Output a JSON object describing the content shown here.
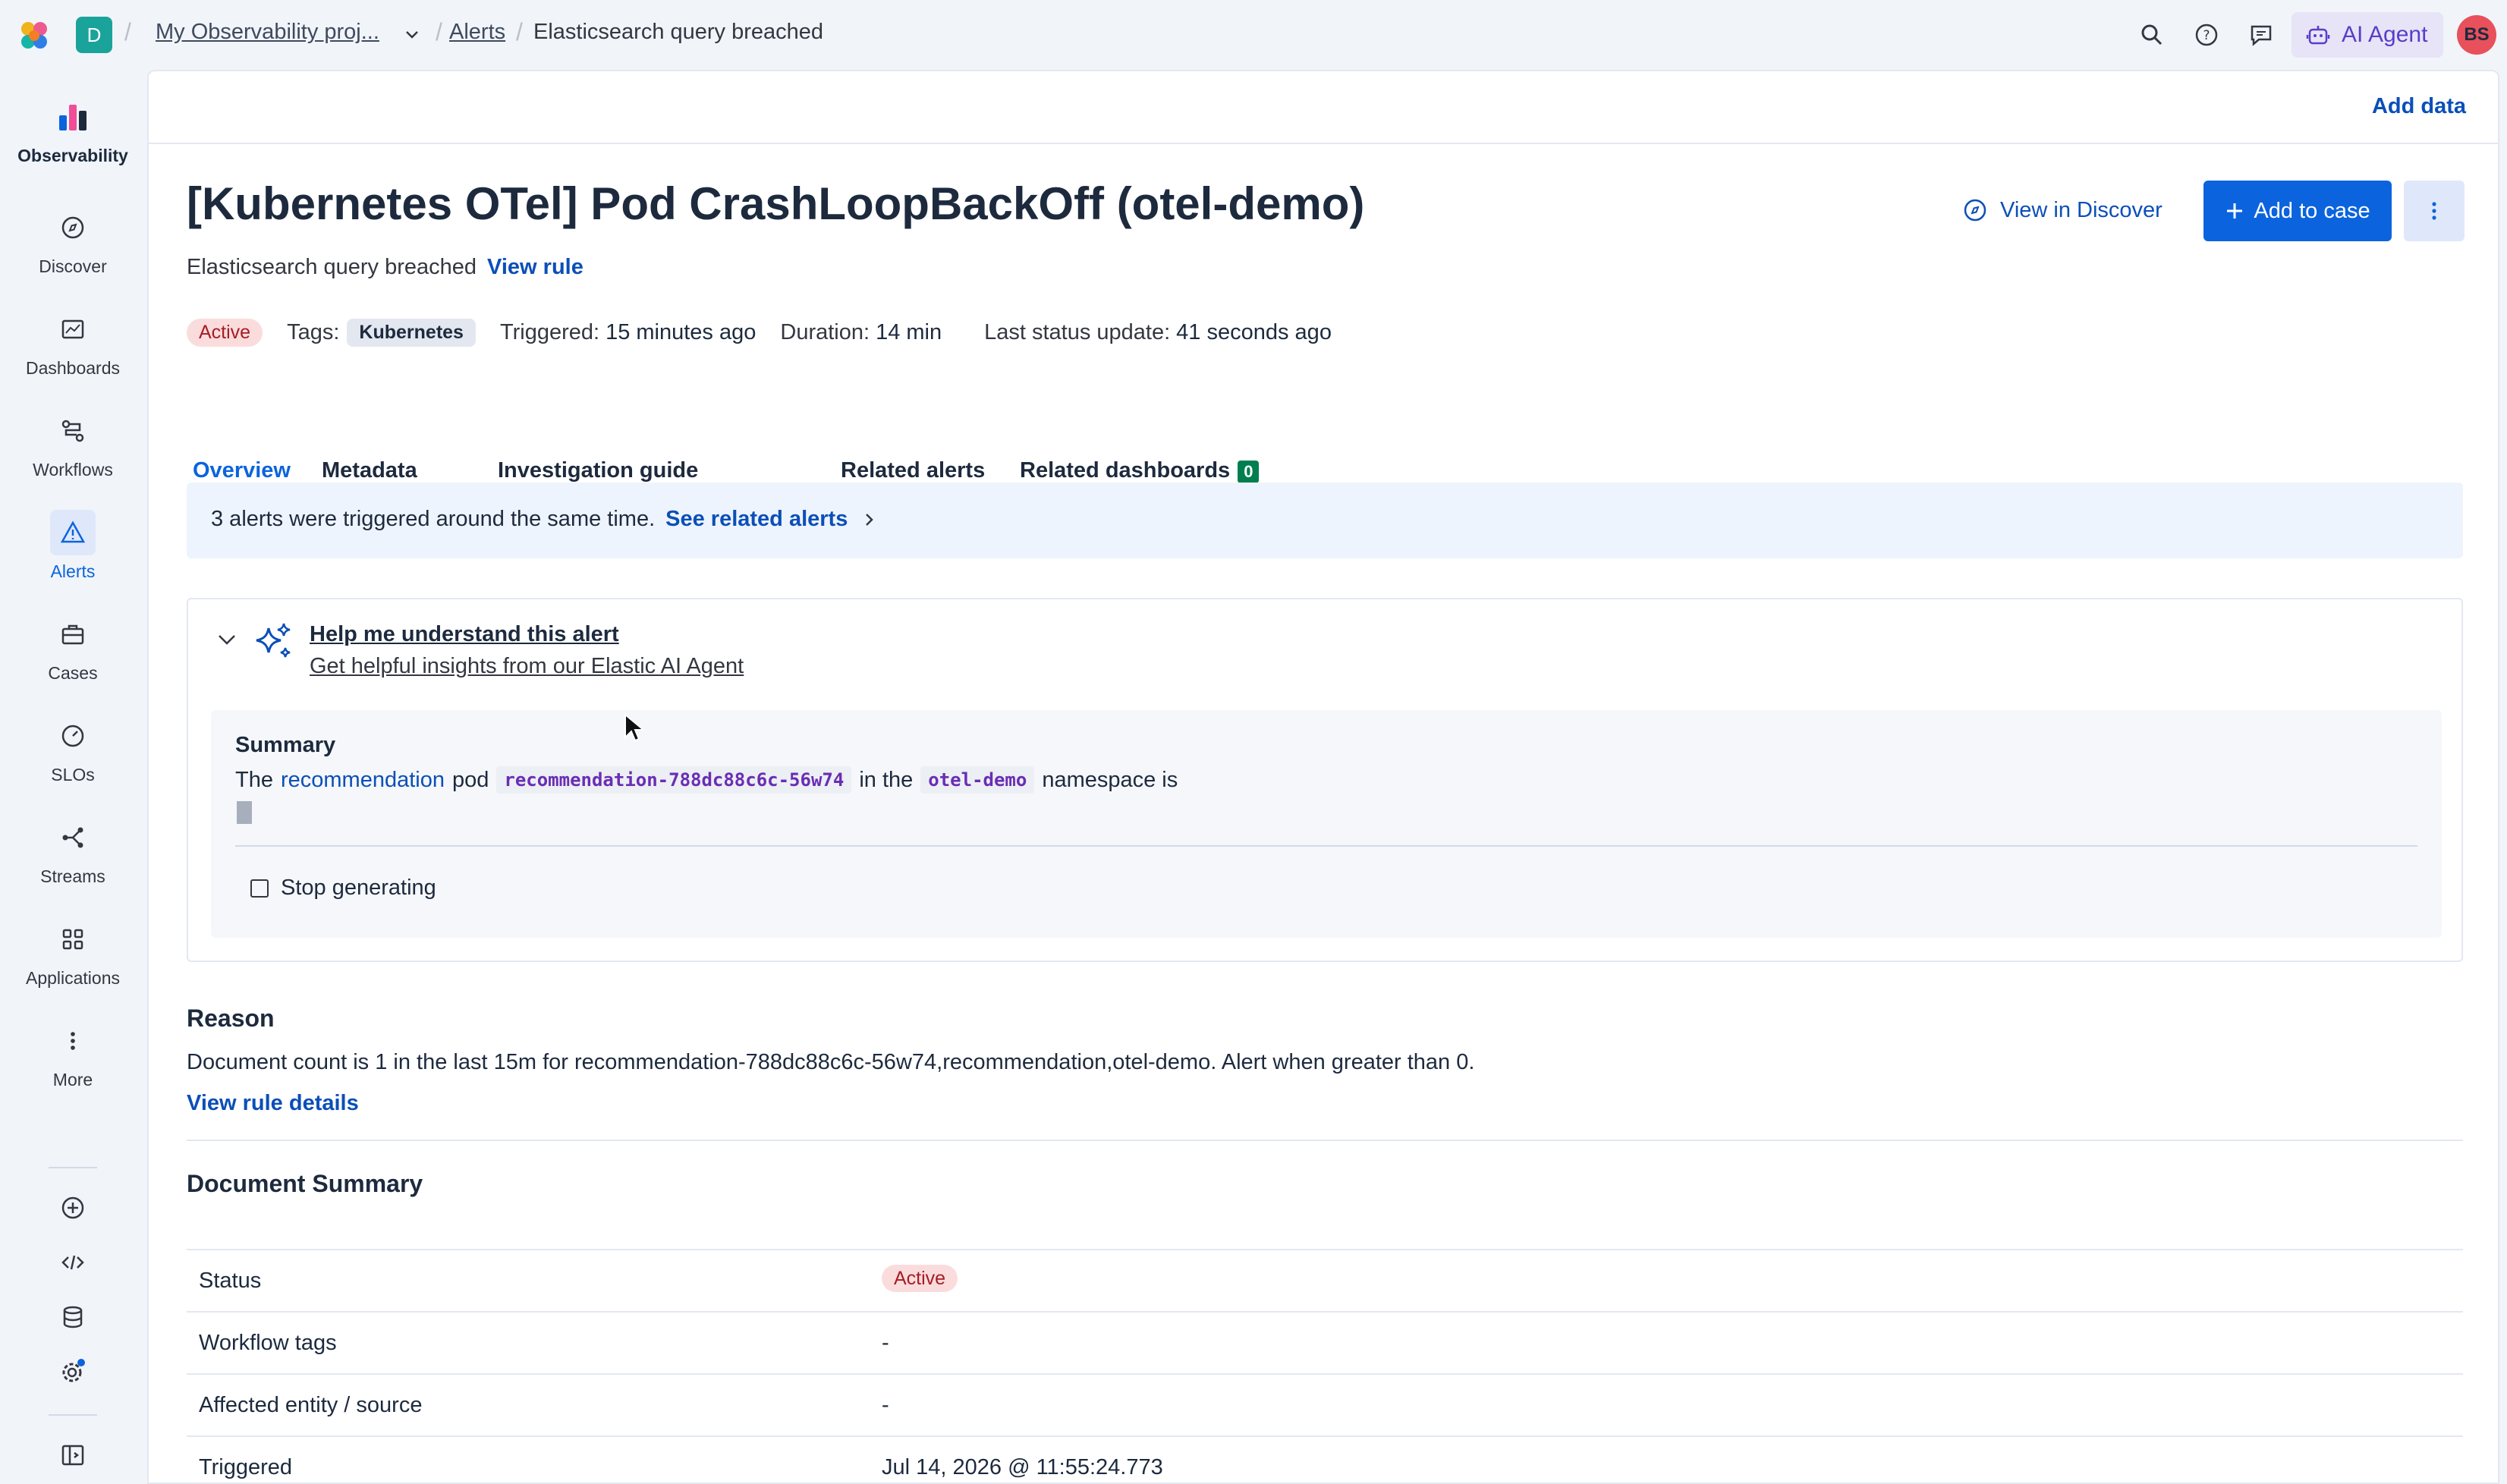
{
  "topbar": {
    "space_initial": "D",
    "breadcrumbs": [
      "My Observability proj...",
      "Alerts",
      "Elasticsearch query breached"
    ],
    "ai_agent_label": "AI Agent",
    "avatar_initials": "BS"
  },
  "sidebar": {
    "brand_label": "Observability",
    "items": [
      {
        "label": "Discover",
        "icon": "compass-icon"
      },
      {
        "label": "Dashboards",
        "icon": "dashboard-icon"
      },
      {
        "label": "Workflows",
        "icon": "workflow-icon"
      },
      {
        "label": "Alerts",
        "icon": "warning-icon"
      },
      {
        "label": "Cases",
        "icon": "briefcase-icon"
      },
      {
        "label": "SLOs",
        "icon": "gauge-icon"
      },
      {
        "label": "Streams",
        "icon": "streams-icon"
      },
      {
        "label": "Applications",
        "icon": "grid-icon"
      },
      {
        "label": "More",
        "icon": "more-icon"
      }
    ]
  },
  "header": {
    "add_data": "Add data",
    "title": "[Kubernetes OTel] Pod CrashLoopBackOff (otel-demo)",
    "subtitle": "Elasticsearch query breached",
    "view_rule": "View rule",
    "view_in_discover": "View in Discover",
    "add_to_case": "Add to case"
  },
  "meta": {
    "status": "Active",
    "tags_label": "Tags:",
    "tag": "Kubernetes",
    "triggered_label": "Triggered:",
    "triggered_value": "15 minutes ago",
    "duration_label": "Duration:",
    "duration_value": "14 min",
    "last_update_label": "Last status update:",
    "last_update_value": "41 seconds ago"
  },
  "tabs": [
    {
      "label": "Overview"
    },
    {
      "label": "Metadata"
    },
    {
      "label": "Investigation guide"
    },
    {
      "label": "Related alerts"
    },
    {
      "label": "Related dashboards",
      "count": "0"
    }
  ],
  "callout": {
    "text": "3 alerts were triggered around the same time.",
    "link": "See related alerts"
  },
  "ai": {
    "title": "Help me understand this alert",
    "subtitle": "Get helpful insights from our Elastic AI Agent",
    "summary_heading": "Summary",
    "summary_prefix": "The",
    "summary_link": "recommendation",
    "summary_pod": "pod",
    "summary_pod_code": "recommendation-788dc88c6c-56w74",
    "summary_in": "in the",
    "summary_ns_code": "otel-demo",
    "summary_suffix": "namespace is",
    "stop_label": "Stop generating"
  },
  "reason": {
    "title": "Reason",
    "text": "Document count is 1 in the last 15m for recommendation-788dc88c6c-56w74,recommendation,otel-demo. Alert when greater than 0.",
    "link": "View rule details"
  },
  "document_summary": {
    "title": "Document Summary",
    "rows": [
      {
        "key": "Status",
        "value": "Active"
      },
      {
        "key": "Workflow tags",
        "value": "-"
      },
      {
        "key": "Affected entity / source",
        "value": "-"
      },
      {
        "key": "Triggered",
        "value": "Jul 14, 2026 @ 11:55:24.773"
      }
    ]
  },
  "colors": {
    "accent": "#0b64dd",
    "link": "#0b4fb8",
    "active_badge_bg": "#fbdcdc",
    "active_badge_text": "#a61c26",
    "count_badge": "#007e4f"
  }
}
